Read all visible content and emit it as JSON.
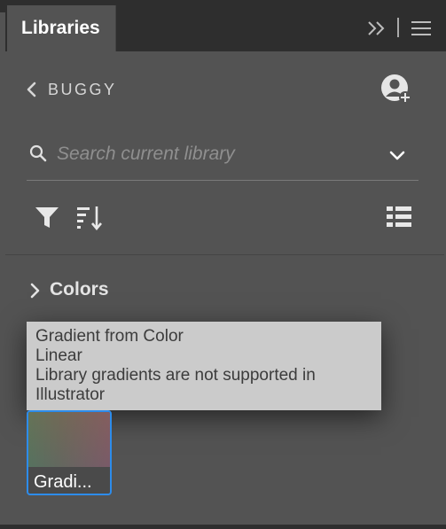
{
  "panel": {
    "tab_label": "Libraries"
  },
  "library": {
    "name": "BUGGY"
  },
  "search": {
    "placeholder": "Search current library",
    "value": ""
  },
  "section": {
    "title": "Colors",
    "expanded": false
  },
  "tooltip": {
    "lines": [
      "Gradient from Color",
      "Linear",
      "Library gradients are not supported in",
      "Illustrator"
    ]
  },
  "items": [
    {
      "label": "Gradi...",
      "selected": true
    }
  ],
  "colors": {
    "panel_bg": "#535353",
    "topbar_bg": "#2e2e2e",
    "tooltip_bg": "#cbcbcb",
    "selection_accent": "#2d8ceb",
    "swatch_gradient": [
      "#5b7a5a",
      "#6e6b5a",
      "#8b5a66"
    ]
  },
  "icons": {
    "topbar": [
      "expand-icon",
      "menu-icon"
    ],
    "header": [
      "back-icon",
      "user-add-icon"
    ],
    "search": [
      "search-icon",
      "chevron-down-icon"
    ],
    "toolbar": [
      "filter-icon",
      "sort-icon",
      "list-view-icon"
    ],
    "section": [
      "chevron-right-icon"
    ]
  }
}
